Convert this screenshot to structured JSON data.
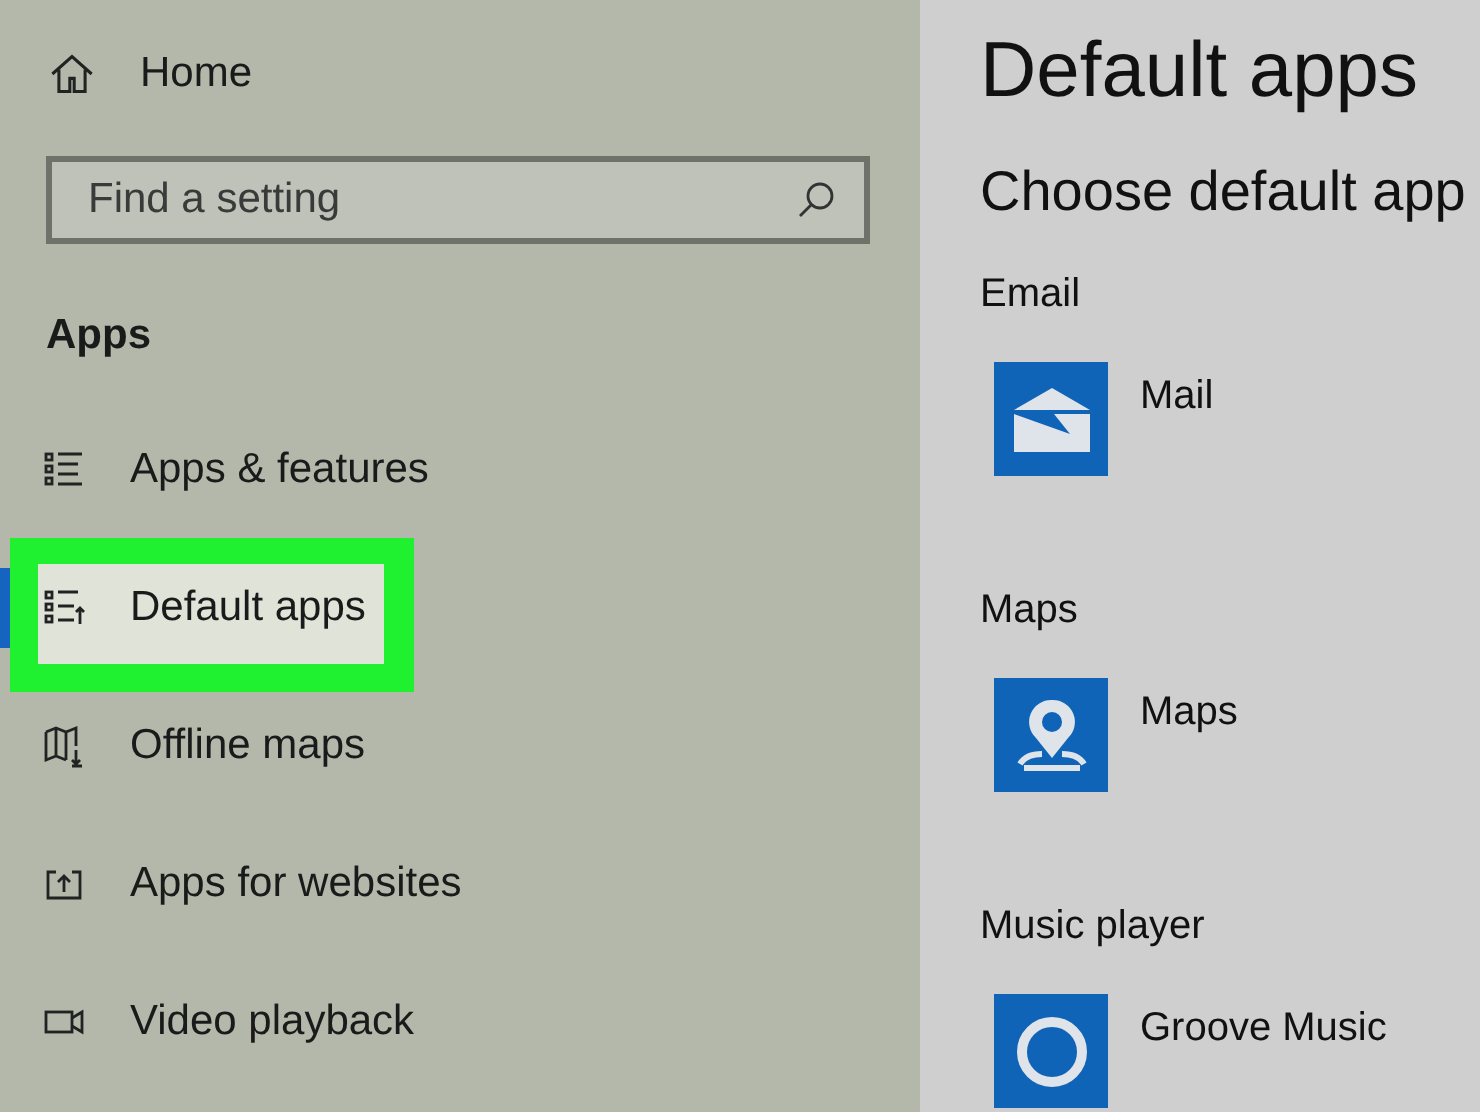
{
  "sidebar": {
    "home": {
      "label": "Home"
    },
    "search": {
      "placeholder": "Find a setting"
    },
    "section_title": "Apps",
    "items": [
      {
        "label": "Apps & features",
        "kind": "list",
        "selected": false
      },
      {
        "label": "Default apps",
        "kind": "list-up",
        "selected": true
      },
      {
        "label": "Offline maps",
        "kind": "map",
        "selected": false
      },
      {
        "label": "Apps for websites",
        "kind": "window",
        "selected": false
      },
      {
        "label": "Video playback",
        "kind": "video",
        "selected": false
      }
    ]
  },
  "main": {
    "title": "Default apps",
    "subtitle": "Choose default app",
    "sections": [
      {
        "heading": "Email",
        "app": "Mail",
        "kind": "mail"
      },
      {
        "heading": "Maps",
        "app": "Maps",
        "kind": "maps"
      },
      {
        "heading": "Music player",
        "app": "Groove Music",
        "kind": "music"
      }
    ]
  }
}
